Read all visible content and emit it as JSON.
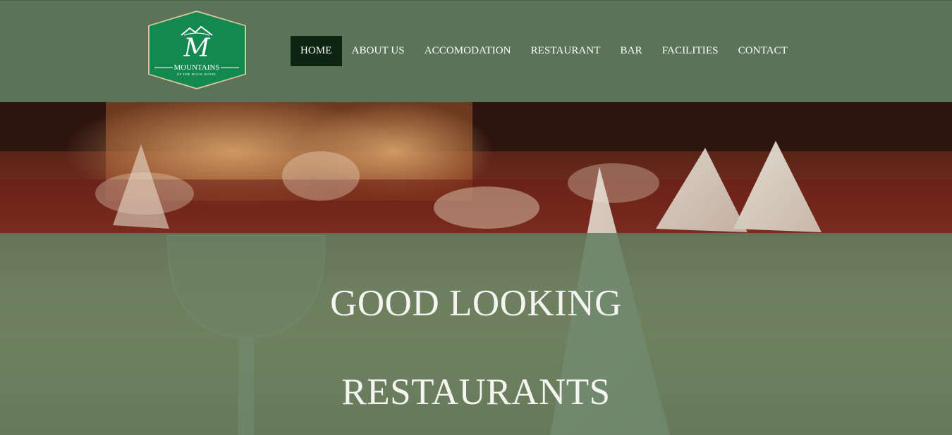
{
  "logo": {
    "name": "MOUNTAINS",
    "tagline": "OF THE MOON HOTEL",
    "monogram": "M",
    "colors": {
      "fill": "#13894f",
      "border": "#d9c89c"
    }
  },
  "nav": {
    "items": [
      {
        "label": "HOME",
        "active": true
      },
      {
        "label": "ABOUT US"
      },
      {
        "label": "ACCOMODATION"
      },
      {
        "label": "RESTAURANT"
      },
      {
        "label": "BAR"
      },
      {
        "label": "FACILITIES"
      },
      {
        "label": "CONTACT"
      }
    ]
  },
  "hero": {
    "line1": "GOOD LOOKING",
    "line2": "RESTAURANTS"
  },
  "colors": {
    "header_bg": "#5a7359",
    "active_nav_bg": "#0d2410",
    "overlay": "#5f7d60"
  }
}
